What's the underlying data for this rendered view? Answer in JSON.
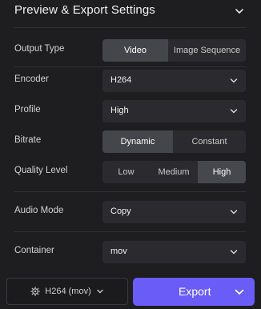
{
  "header": {
    "title": "Preview & Export Settings"
  },
  "output_type": {
    "label": "Output Type",
    "options": [
      "Video",
      "Image Sequence"
    ],
    "selected": "Video"
  },
  "encoder": {
    "label": "Encoder",
    "value": "H264"
  },
  "profile": {
    "label": "Profile",
    "value": "High"
  },
  "bitrate": {
    "label": "Bitrate",
    "options": [
      "Dynamic",
      "Constant"
    ],
    "selected": "Dynamic"
  },
  "quality": {
    "label": "Quality Level",
    "options": [
      "Low",
      "Medium",
      "High"
    ],
    "selected": "High"
  },
  "audio": {
    "label": "Audio Mode",
    "value": "Copy"
  },
  "container": {
    "label": "Container",
    "value": "mov"
  },
  "footer": {
    "preset_label": "H264 (mov)",
    "export_label": "Export"
  },
  "colors": {
    "accent": "#6a5cf6",
    "panel_bg": "#1e1e20",
    "control_bg": "#2b2b2f",
    "selected_bg": "#44464b"
  }
}
